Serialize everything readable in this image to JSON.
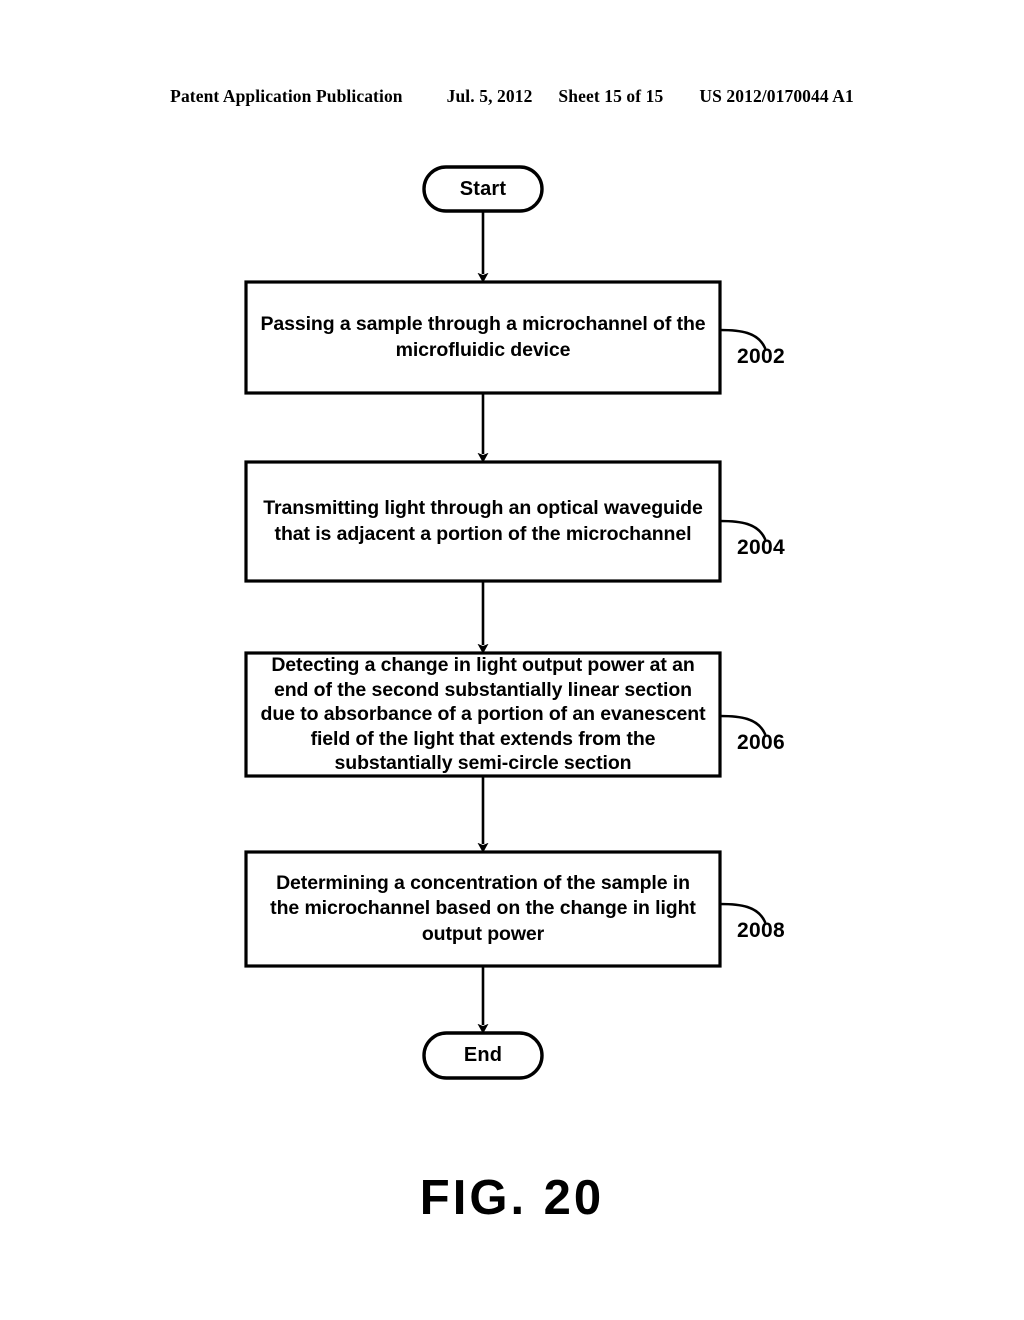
{
  "header": {
    "publication_label": "Patent Application Publication",
    "date": "Jul. 5, 2012",
    "sheet": "Sheet 15 of 15",
    "publication_number": "US 2012/0170044 A1"
  },
  "figure": {
    "caption": "FIG. 20"
  },
  "colors": {
    "stroke": "#000000",
    "fill": "#ffffff",
    "text": "#000000"
  },
  "flowchart": {
    "type": "flowchart",
    "orientation": "vertical",
    "nodes": [
      {
        "id": "start",
        "shape": "terminator",
        "label": "Start",
        "ref": null
      },
      {
        "id": "step-2002",
        "shape": "process",
        "label": "Passing a sample through a microchannel of the microfluidic device",
        "ref": "2002"
      },
      {
        "id": "step-2004",
        "shape": "process",
        "label": "Transmitting light through an optical waveguide that is adjacent a portion of the microchannel",
        "ref": "2004"
      },
      {
        "id": "step-2006",
        "shape": "process",
        "label": "Detecting a change in light output power at an end of the second substantially linear section due to absorbance of a portion of an evanescent field of the light that extends from the substantially semi-circle section",
        "ref": "2006"
      },
      {
        "id": "step-2008",
        "shape": "process",
        "label": "Determining a concentration of the sample in the microchannel based on the change in light output power",
        "ref": "2008"
      },
      {
        "id": "end",
        "shape": "terminator",
        "label": "End",
        "ref": null
      }
    ],
    "edges": [
      {
        "from": "start",
        "to": "step-2002",
        "arrow": "down"
      },
      {
        "from": "step-2002",
        "to": "step-2004",
        "arrow": "down"
      },
      {
        "from": "step-2004",
        "to": "step-2006",
        "arrow": "down"
      },
      {
        "from": "step-2006",
        "to": "step-2008",
        "arrow": "down"
      },
      {
        "from": "step-2008",
        "to": "end",
        "arrow": "down"
      }
    ]
  }
}
